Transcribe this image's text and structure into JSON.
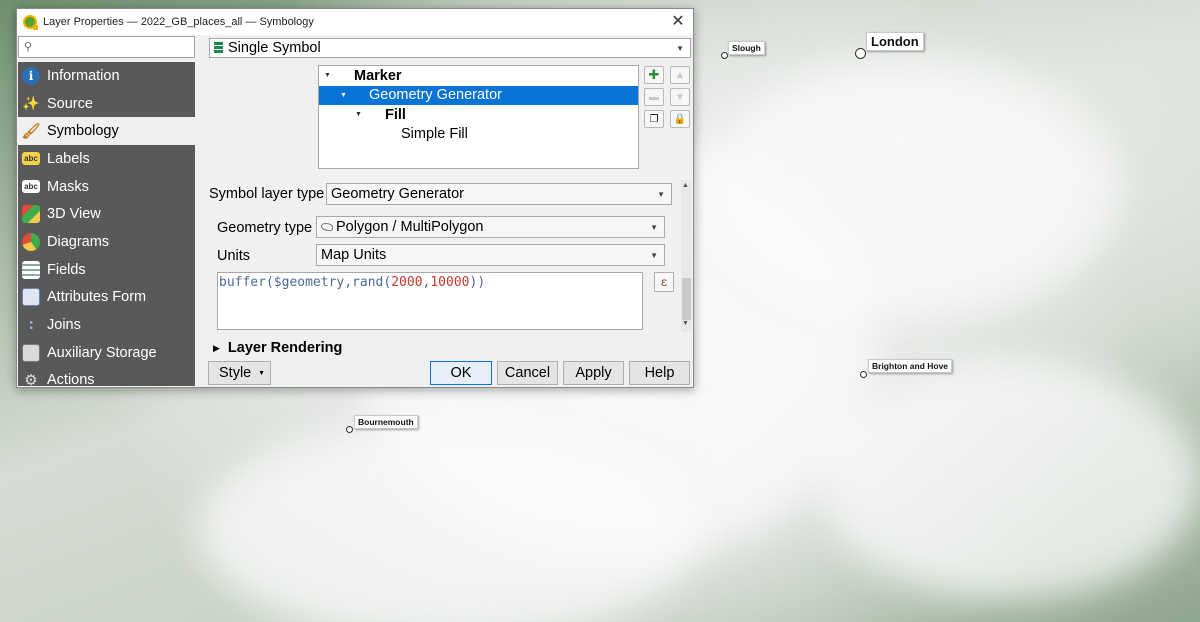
{
  "window": {
    "title": "Layer Properties — 2022_GB_places_all — Symbology",
    "close_glyph": "✕"
  },
  "search": {
    "placeholder": "",
    "value": ""
  },
  "nav": {
    "items": [
      {
        "label": "Information",
        "icon": "info-icon",
        "active": false
      },
      {
        "label": "Source",
        "icon": "source-icon",
        "active": false
      },
      {
        "label": "Symbology",
        "icon": "paintbrush-icon",
        "active": true
      },
      {
        "label": "Labels",
        "icon": "labels-icon",
        "active": false
      },
      {
        "label": "Masks",
        "icon": "masks-icon",
        "active": false
      },
      {
        "label": "3D View",
        "icon": "cube-icon",
        "active": false
      },
      {
        "label": "Diagrams",
        "icon": "diagrams-icon",
        "active": false
      },
      {
        "label": "Fields",
        "icon": "fields-icon",
        "active": false
      },
      {
        "label": "Attributes Form",
        "icon": "form-icon",
        "active": false
      },
      {
        "label": "Joins",
        "icon": "joins-icon",
        "active": false
      },
      {
        "label": "Auxiliary Storage",
        "icon": "storage-icon",
        "active": false
      },
      {
        "label": "Actions",
        "icon": "actions-icon",
        "active": false
      }
    ]
  },
  "renderer": {
    "value": "Single Symbol"
  },
  "symbol_tree": {
    "rows": [
      {
        "label": "Marker",
        "bold": true
      },
      {
        "label": "Geometry Generator",
        "bold": false,
        "selected": true
      },
      {
        "label": "Fill",
        "bold": true
      },
      {
        "label": "Simple Fill",
        "bold": false
      }
    ]
  },
  "symbol_layer": {
    "type_label": "Symbol layer type",
    "type_value": "Geometry Generator",
    "geometry_type_label": "Geometry type",
    "geometry_type_value": "Polygon / MultiPolygon",
    "units_label": "Units",
    "units_value": "Map Units",
    "expression": {
      "func": "buffer",
      "arg1": "$geometry",
      "inner_func": "rand",
      "min": "2000",
      "max": "10000"
    },
    "expression_button": "ε"
  },
  "layer_rendering": {
    "label": "Layer Rendering"
  },
  "buttons": {
    "style": "Style",
    "ok": "OK",
    "cancel": "Cancel",
    "apply": "Apply",
    "help": "Help"
  },
  "map": {
    "places": [
      {
        "name": "London",
        "size": "big"
      },
      {
        "name": "Slough",
        "size": "small"
      },
      {
        "name": "Brighton and Hove",
        "size": "small"
      },
      {
        "name": "Bournemouth",
        "size": "small"
      }
    ]
  }
}
